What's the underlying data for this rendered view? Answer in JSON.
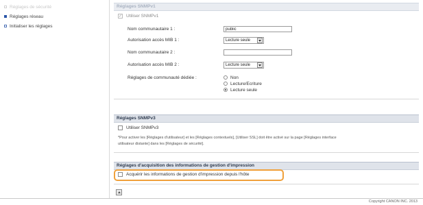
{
  "sidebar": {
    "items": [
      {
        "label": "Réglages de sécurité"
      },
      {
        "label": "Réglages réseau"
      },
      {
        "label": "Initialiser les réglages"
      }
    ]
  },
  "snmpv1": {
    "header": "Réglages SNMPv1",
    "use_label": "Utiliser SNMPv1",
    "use_checked_mark": "✓",
    "community1_label": "Nom communautaire 1 :",
    "community1_value": "public",
    "mib1_label": "Autorisation accès MIB 1 :",
    "mib1_value": "Lecture seule",
    "community2_label": "Nom communautaire 2 :",
    "community2_value": "",
    "mib2_label": "Autorisation accès MIB 2 :",
    "mib2_value": "Lecture seule",
    "dedicated_label": "Réglages de communauté dédiée :",
    "dedicated_options": [
      "Non",
      "Lecture/Ecriture",
      "Lecture seule"
    ],
    "dedicated_selected": "Lecture seule"
  },
  "snmpv3": {
    "header": "Réglages SNMPv3",
    "use_label": "Utiliser SNMPv3",
    "note_line1": "*Pour activer les [Réglages d'utilisateur] et les [Réglages contextuels], [Utiliser SSL] doit être activé sur la page [Réglages interface",
    "note_line2": "utilisateur distante] dans les [Réglages de sécurité]."
  },
  "acquisition": {
    "header": "Réglages d'acquisition des informations de gestion d'impression",
    "checkbox_label": "Acquérir les informations de gestion d'impression depuis l'hôte"
  },
  "footer": {
    "copyright": "Copyright CANON INC. 2013"
  },
  "colors": {
    "highlight": "#f0a03a",
    "section_header_bg": "#dfe3ea"
  }
}
